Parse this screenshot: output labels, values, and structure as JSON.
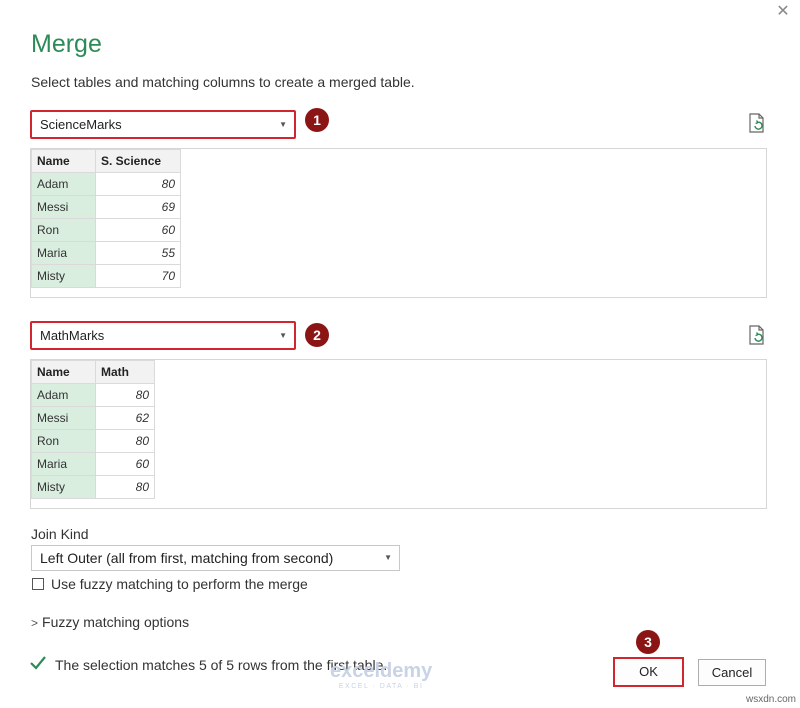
{
  "dialog": {
    "title": "Merge",
    "subtitle": "Select tables and matching columns to create a merged table.",
    "close_glyph": "✕"
  },
  "table1": {
    "selected": "ScienceMarks",
    "badge": "1",
    "columns": [
      "Name",
      "S. Science"
    ],
    "rows": [
      [
        "Adam",
        "80"
      ],
      [
        "Messi",
        "69"
      ],
      [
        "Ron",
        "60"
      ],
      [
        "Maria",
        "55"
      ],
      [
        "Misty",
        "70"
      ]
    ]
  },
  "table2": {
    "selected": "MathMarks",
    "badge": "2",
    "columns": [
      "Name",
      "Math"
    ],
    "rows": [
      [
        "Adam",
        "80"
      ],
      [
        "Messi",
        "62"
      ],
      [
        "Ron",
        "80"
      ],
      [
        "Maria",
        "60"
      ],
      [
        "Misty",
        "80"
      ]
    ]
  },
  "join": {
    "label": "Join Kind",
    "selected": "Left Outer (all from first, matching from second)",
    "fuzzy_checkbox_label": "Use fuzzy matching to perform the merge",
    "fuzzy_checked": false,
    "fuzzy_options_label": "Fuzzy matching options",
    "fuzzy_options_chevron": ">"
  },
  "status": {
    "text": "The selection matches 5 of 5 rows from the first table.",
    "icon": "check-icon"
  },
  "buttons": {
    "ok": "OK",
    "cancel": "Cancel",
    "ok_badge": "3"
  },
  "watermark": {
    "brand": "exceldemy",
    "tagline": "EXCEL · DATA · BI"
  },
  "footer_site": "wsxdn.com",
  "colors": {
    "title": "#2e8b57",
    "highlight": "#d0262e",
    "badge": "#8b1414",
    "key_column": "#d9eedf",
    "check": "#2e8b57"
  }
}
